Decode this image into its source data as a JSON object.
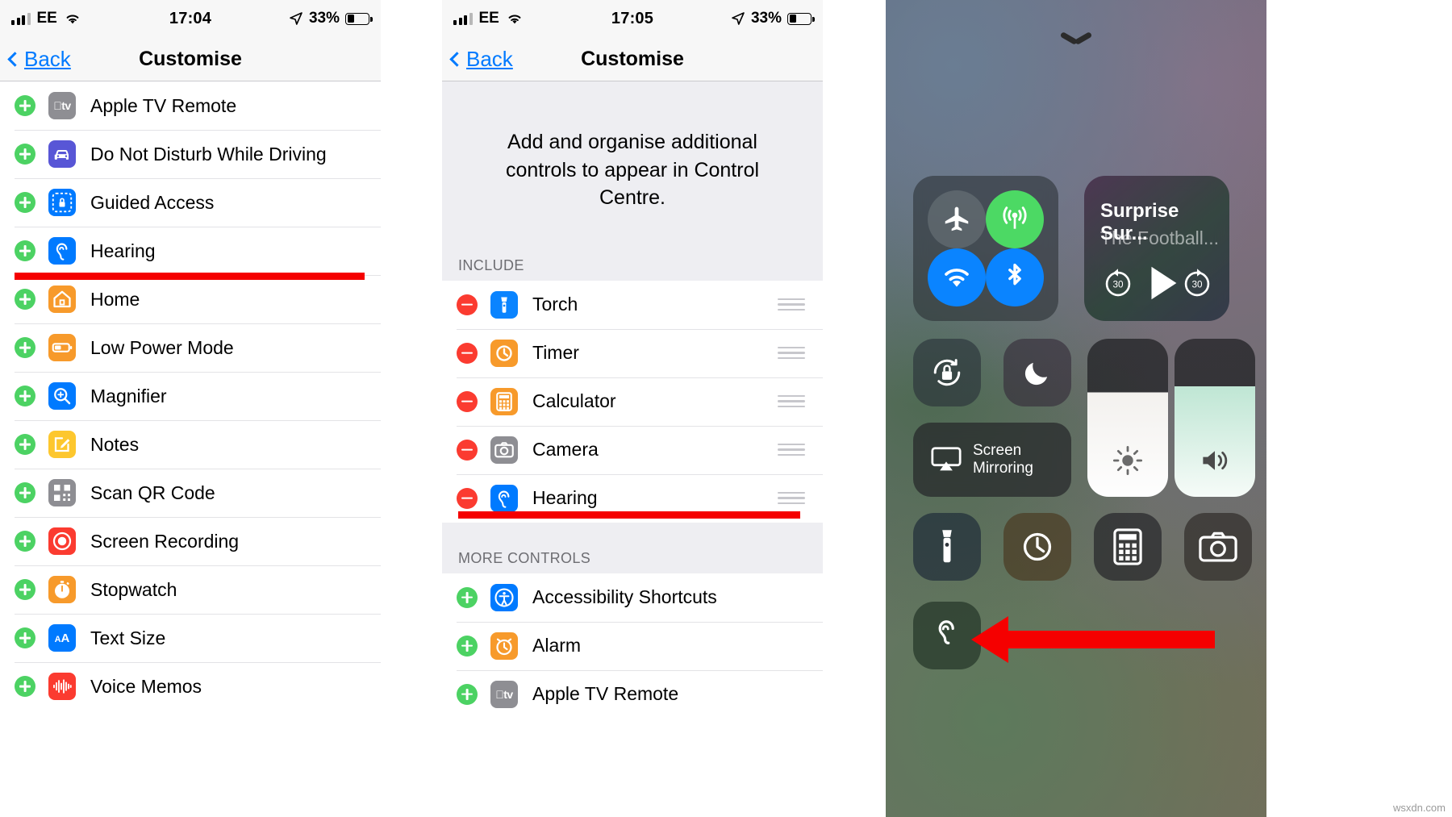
{
  "left_panel": {
    "status": {
      "signal_carrier": "EE",
      "time": "17:04",
      "battery_pct": "33%"
    },
    "nav": {
      "back_label": "Back",
      "title": "Customise"
    },
    "rows": [
      {
        "action": "add",
        "label": "Apple TV Remote",
        "icon": "apple-tv-icon",
        "color": "#8e8e93"
      },
      {
        "action": "add",
        "label": "Do Not Disturb While Driving",
        "icon": "car-icon",
        "color": "#5856d6"
      },
      {
        "action": "add",
        "label": "Guided Access",
        "icon": "lock-dashed-icon",
        "color": "#007aff"
      },
      {
        "action": "add",
        "label": "Hearing",
        "icon": "ear-icon",
        "color": "#007aff"
      },
      {
        "action": "add",
        "label": "Home",
        "icon": "house-icon",
        "color": "#f79a2b"
      },
      {
        "action": "add",
        "label": "Low Power Mode",
        "icon": "battery-icon",
        "color": "#f79a2b"
      },
      {
        "action": "add",
        "label": "Magnifier",
        "icon": "magnifier-icon",
        "color": "#007aff"
      },
      {
        "action": "add",
        "label": "Notes",
        "icon": "notes-pencil-icon",
        "color": "#fdc72e"
      },
      {
        "action": "add",
        "label": "Scan QR Code",
        "icon": "qr-code-icon",
        "color": "#8e8e93"
      },
      {
        "action": "add",
        "label": "Screen Recording",
        "icon": "record-circle-icon",
        "color": "#fb3b30"
      },
      {
        "action": "add",
        "label": "Stopwatch",
        "icon": "stopwatch-icon",
        "color": "#f79a2b"
      },
      {
        "action": "add",
        "label": "Text Size",
        "icon": "text-size-icon",
        "color": "#007aff"
      },
      {
        "action": "add",
        "label": "Voice Memos",
        "icon": "waveform-icon",
        "color": "#fb3b30"
      }
    ]
  },
  "mid_panel": {
    "status": {
      "signal_carrier": "EE",
      "time": "17:05",
      "battery_pct": "33%"
    },
    "nav": {
      "back_label": "Back",
      "title": "Customise"
    },
    "intro": "Add and organise additional controls to appear in Control Centre.",
    "include_header": "INCLUDE",
    "include_rows": [
      {
        "action": "remove",
        "label": "Torch",
        "icon": "torch-icon",
        "color": "#0a84ff"
      },
      {
        "action": "remove",
        "label": "Timer",
        "icon": "timer-icon",
        "color": "#f79a2b"
      },
      {
        "action": "remove",
        "label": "Calculator",
        "icon": "calculator-icon",
        "color": "#f79a2b"
      },
      {
        "action": "remove",
        "label": "Camera",
        "icon": "camera-icon",
        "color": "#8e8e93"
      },
      {
        "action": "remove",
        "label": "Hearing",
        "icon": "ear-icon",
        "color": "#007aff"
      }
    ],
    "more_header": "MORE CONTROLS",
    "more_rows": [
      {
        "action": "add",
        "label": "Accessibility Shortcuts",
        "icon": "accessibility-icon",
        "color": "#007aff"
      },
      {
        "action": "add",
        "label": "Alarm",
        "icon": "alarm-clock-icon",
        "color": "#f79a2b"
      },
      {
        "action": "add",
        "label": "Apple TV Remote",
        "icon": "apple-tv-icon",
        "color": "#8e8e93"
      }
    ]
  },
  "control_centre": {
    "connectivity": [
      "airplane-icon",
      "cellular-data-icon",
      "wifi-icon",
      "bluetooth-icon"
    ],
    "media": {
      "title": "Surprise Sur...",
      "subtitle": "The Football...",
      "back_seconds": "30",
      "forward_seconds": "30"
    },
    "tiles": [
      "rotation-lock-icon",
      "do-not-disturb-icon"
    ],
    "screen_mirroring": {
      "line1": "Screen",
      "line2": "Mirroring"
    },
    "sliders": [
      "brightness-icon",
      "volume-icon"
    ],
    "shortcuts": [
      "torch-icon",
      "timer-icon",
      "calculator-icon",
      "camera-icon",
      "hearing-icon"
    ]
  },
  "annotations": {
    "accent_red": "#f50000",
    "marks": [
      "underline-hearing-left",
      "underline-hearing-mid",
      "arrow-to-hearing-control"
    ]
  },
  "watermark": "wsxdn.com"
}
